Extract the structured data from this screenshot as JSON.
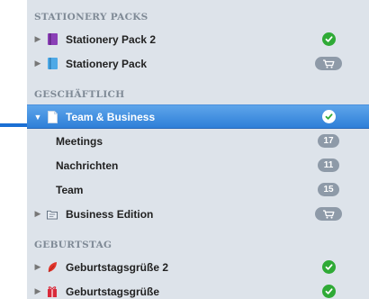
{
  "sections": [
    {
      "header": "STATIONERY PACKS",
      "items": [
        {
          "label": "Stationery Pack 2",
          "icon": "purple-book-icon",
          "badge_type": "check"
        },
        {
          "label": "Stationery Pack",
          "icon": "blue-book-icon",
          "badge_type": "cart"
        }
      ]
    },
    {
      "header": "GESCHÄFTLICH",
      "items": [
        {
          "label": "Team & Business",
          "icon": "document-icon",
          "badge_type": "check",
          "selected": true,
          "expanded": true,
          "children": [
            {
              "label": "Meetings",
              "count": "17"
            },
            {
              "label": "Nachrichten",
              "count": "11"
            },
            {
              "label": "Team",
              "count": "15"
            }
          ]
        },
        {
          "label": "Business Edition",
          "icon": "folder-icon",
          "badge_type": "cart"
        }
      ]
    },
    {
      "header": "GEBURTSTAG",
      "items": [
        {
          "label": "Geburtstagsgrüße 2",
          "icon": "red-leaf-icon",
          "badge_type": "check"
        },
        {
          "label": "Geburtstagsgrüße",
          "icon": "red-gift-icon",
          "badge_type": "check"
        }
      ]
    }
  ],
  "colors": {
    "sidebar_bg": "#dde3ea",
    "selection": "#2e7fd8",
    "badge_gray": "#8e9aa8",
    "check_green": "#2faa36",
    "pointer_line": "#1a6fd4"
  }
}
